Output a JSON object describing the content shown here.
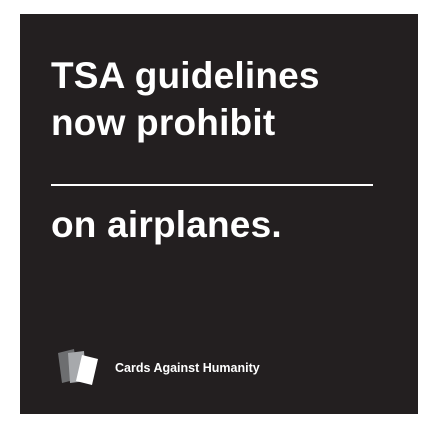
{
  "card": {
    "line_1": "TSA guidelines",
    "line_2": "now prohibit",
    "line_3": "on airplanes.",
    "brand": "Cards Against Humanity"
  },
  "colors": {
    "card_background": "#231f20",
    "text": "#ffffff",
    "page_background": "#ffffff"
  },
  "icons": [
    "card-stack-logo-icon"
  ]
}
